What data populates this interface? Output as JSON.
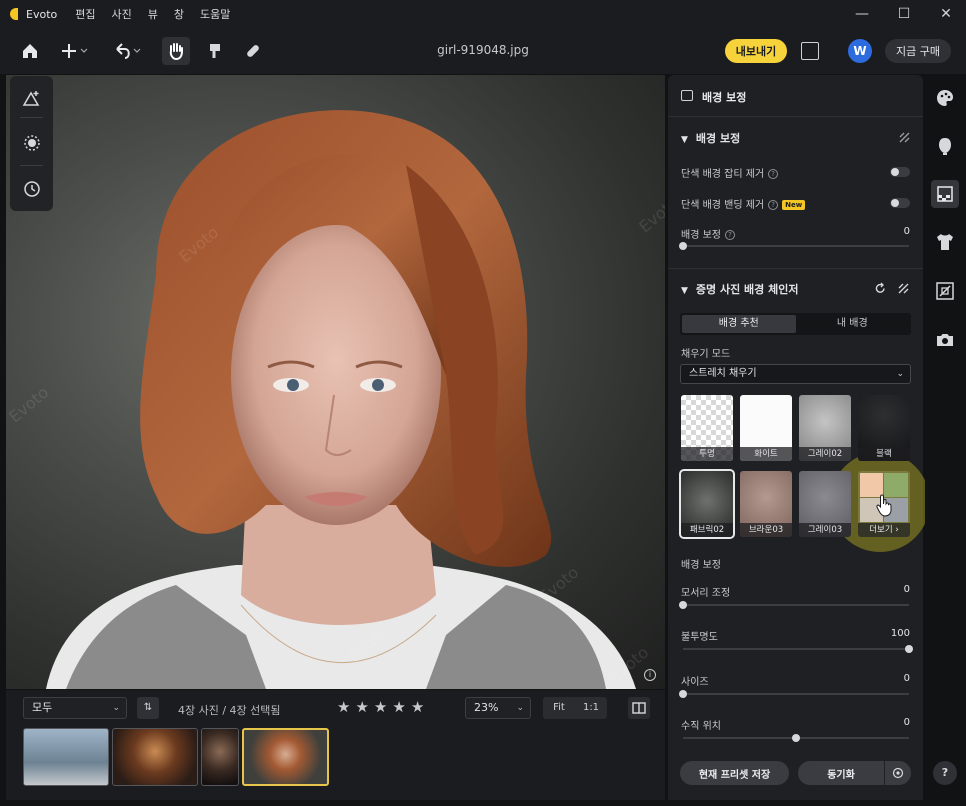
{
  "app": {
    "name": "Evoto",
    "menu": [
      "편집",
      "사진",
      "뷰",
      "창",
      "도움말"
    ]
  },
  "toolbar": {
    "filename": "girl-919048.jpg",
    "export_label": "내보내기",
    "avatar_letter": "W",
    "buy_label": "지금 구매"
  },
  "canvas": {
    "watermark": "Evoto"
  },
  "filmstrip": {
    "filter_value": "모두",
    "sort_label": "⇅",
    "count_text": "4장 사진 / 4장 선택됨",
    "star_count": 5,
    "zoom_value": "23%",
    "fit_label": "Fit",
    "one_to_one_label": "1:1"
  },
  "panel": {
    "title": "배경 보정",
    "section1": {
      "title": "배경 보정",
      "row1_label": "단색 배경 잡티 제거",
      "row2_label": "단색 배경 밴딩 제거",
      "new_badge": "New",
      "row3_label": "배경 보정",
      "row3_value": "0"
    },
    "section2": {
      "title": "증명 사진 배경 체인저",
      "tab_recommend": "배경 추천",
      "tab_mine": "내 배경",
      "fill_mode_label": "채우기 모드",
      "fill_mode_value": "스트레치 채우기",
      "tiles": [
        "투명",
        "화이트",
        "그레이02",
        "블랙",
        "패브릭02",
        "브라운03",
        "그레이03",
        "더보기 ›"
      ],
      "adjust_label": "배경 보정",
      "sliders": [
        {
          "label": "모서리 조정",
          "value": "0",
          "pos": 0
        },
        {
          "label": "불투명도",
          "value": "100",
          "pos": 100
        },
        {
          "label": "사이즈",
          "value": "0",
          "pos": 0
        },
        {
          "label": "수직 위치",
          "value": "0",
          "pos": 50
        }
      ]
    },
    "save_preset_label": "현재 프리셋 저장",
    "sync_label": "동기화"
  },
  "rail": {
    "help_label": "?"
  },
  "colors": {
    "accent": "#f6d23b",
    "panel_bg": "#1f2023",
    "avatar": "#2d6cdf"
  }
}
